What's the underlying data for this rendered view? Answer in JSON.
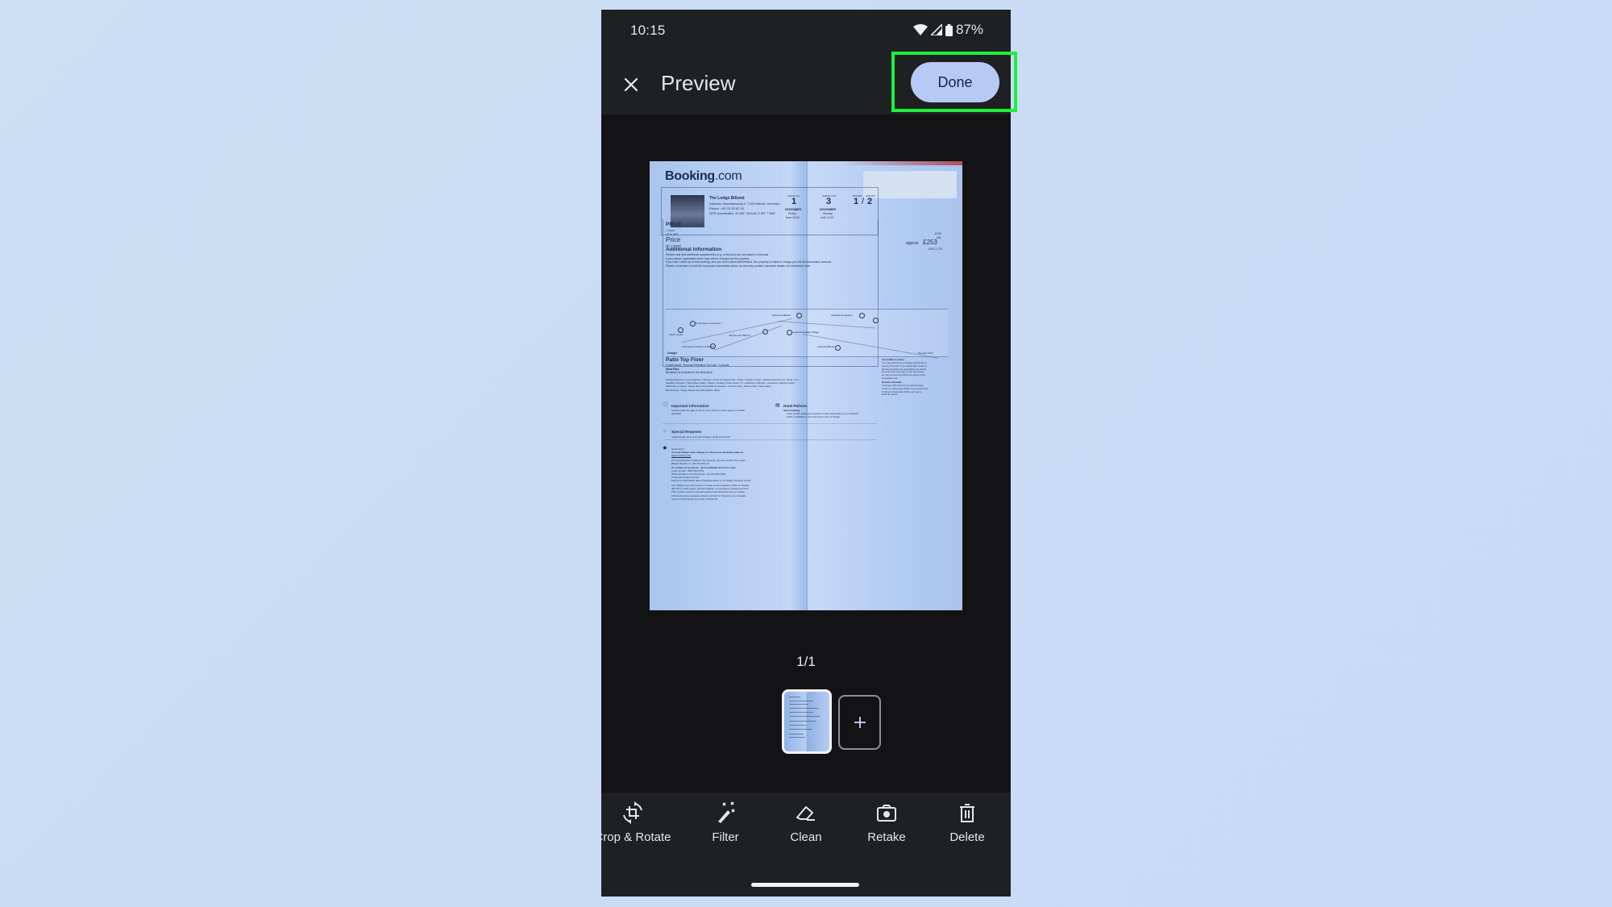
{
  "status_bar": {
    "time": "10:15",
    "battery": "87%",
    "icons": [
      "wifi-icon",
      "cellular-signal-icon",
      "battery-icon"
    ]
  },
  "header": {
    "close_icon": "close-icon",
    "title": "Preview",
    "done_label": "Done"
  },
  "highlight": {
    "target": "done-button",
    "color": "#19f23a"
  },
  "document": {
    "brand": "Booking",
    "brand_suffix": ".com",
    "hotel_name": "The Lodge Billund",
    "address": "Address: Nordmarksvej 3, 7190 Billund, Denmark",
    "phone": "Phone: +45 75 33 81 33",
    "gps": "GPS coordinates: N 055° 43.845, E 09° 7.963",
    "check_in": {
      "label": "CHECK-IN",
      "day": "1",
      "month": "DECEMBER",
      "weekday": "Friday",
      "time": "from 15:00"
    },
    "check_out": {
      "label": "CHECK-OUT",
      "day": "3",
      "month": "DECEMBER",
      "weekday": "Sunday",
      "time": "until 11:00"
    },
    "rooms_label": "ROOMS",
    "nights_label": "NIGHTS",
    "rooms": "1",
    "nights": "2",
    "price_heading": "PRICE",
    "price_lines": [
      "1 room",
      "25 % VAT"
    ],
    "price_label": "Price",
    "price_guest": "(for 1 guest)",
    "price_small": [
      "£202",
      "£51"
    ],
    "price_approx": "approx.",
    "price_total": "£253",
    "price_dkk": "DKK 2,176",
    "additional_heading": "Additional information",
    "additional_lines": [
      "Please note that additional supplements (e.g. extra bed) are not added in this total.",
      "If you cancel, applicable taxes may still be charged by the property.",
      "If you don't show up at this booking, and you don't cancel beforehand, the property is liable to charge you the full reservation amount.",
      "Please remember to read the Important information below, as this may contain important details not mentioned here."
    ],
    "map_labels": [
      "Teddy Bear Art Museum",
      "LEGO House",
      "Skulpturpark Billund",
      "International School of Billund",
      "Naturama Billund",
      "Legoland Holiday Village",
      "Lalandia Hundeskov",
      "Lalandia Billund",
      "Google",
      "Map data ©2023"
    ],
    "room_heading": "Patio Top Floor",
    "guest_name": "Guest name: Thomas Pritchard / for max. 2 people",
    "meal_plan": "Meal Plan:",
    "meal_desc": "Breakfast is included in the final price.",
    "amenities": [
      "Private bathroom • Free toiletries • Shower • Inner courtyard view • Toilet • Towels • Linen • Socket near the bed • Desk • TV •",
      "Satellite channels • Tea/Coffee maker • Radio • Heating • Flat-screen TV • Hairdryer • Minibar • Carpeted • Electric kettle •",
      "Wardrobe or closet • Upper floors accessible by elevator • Clothes rack • Fold-up bed • Toilet paper"
    ],
    "bed_size": "Bed Size(s): 1 large double bed (151-180cm wide)",
    "cancellation_heading": "Cancellation policy:",
    "cancellation_lines": [
      "You may cancel free of charge until 14:00 on",
      "the day of arrival. If you cancel after 14:00 on",
      "the day of arrival, the cancellation fee will be",
      "the cost of the first night. If you don't show",
      "up, the no-show fee will be the same as the",
      "cancellation fee."
    ],
    "refund_heading": "Refund schedule:",
    "refund_lines": [
      "You'll get a full refund if you cancel before",
      "13:59 on 1 December 2023. If you cancel from",
      "14:00 on 1 December 2023, you'll get a",
      "£126.36 refund."
    ],
    "important_heading": "Important information",
    "important_lines": [
      "Guests under the age of 18 can only check in with a parent or official",
      "guardian."
    ],
    "policies_heading": "Hotel Policies",
    "policies_sub": "Guest parking",
    "policies_lines": [
      "• Free private parking is possible on site (reservation is not needed).",
      "• WiFi is available in all areas and is free of charge."
    ],
    "requests_heading": "Special Requests",
    "requests_line": "\"Approximate time of arrival: between 21:00 and 22:00\"",
    "help_heading": "Need help?",
    "help_lines": [
      "You can always view, change or cancel your booking online at:",
      "www.booking.com",
      "For any questions related to the property, you can contact The Lodge",
      "Billund directly on: +45 75 33 81 33",
      "Or contact us by phone - we're available 24 hours a day:",
      "Local number: 0203 564 6725",
      "When abroad or from Denmark: +44 20 3320 2609",
      "Travel with peace of mind",
      "Find more information about travelling safely in our Safety resource centre",
      "Your safety is our top concern. In case of an emergency while on holiday,",
      "dial 112 to reach police, the fire brigade, or emergency medical services.",
      "This number works in most European countries and is free of charge.",
      "Find more local emergency phone numbers to help give you complete",
      "peace of mind during your stay in Denmark."
    ]
  },
  "pager": {
    "current": 1,
    "total": 1,
    "text": "1/1"
  },
  "thumbnails": [
    {
      "page": 1,
      "selected": true
    }
  ],
  "add_page_icon": "plus-icon",
  "toolbar": [
    {
      "label": "Crop & Rotate",
      "icon": "crop-rotate-icon"
    },
    {
      "label": "Filter",
      "icon": "magic-wand-icon"
    },
    {
      "label": "Clean",
      "icon": "eraser-icon"
    },
    {
      "label": "Retake",
      "icon": "camera-icon"
    },
    {
      "label": "Delete",
      "icon": "trash-icon"
    }
  ]
}
